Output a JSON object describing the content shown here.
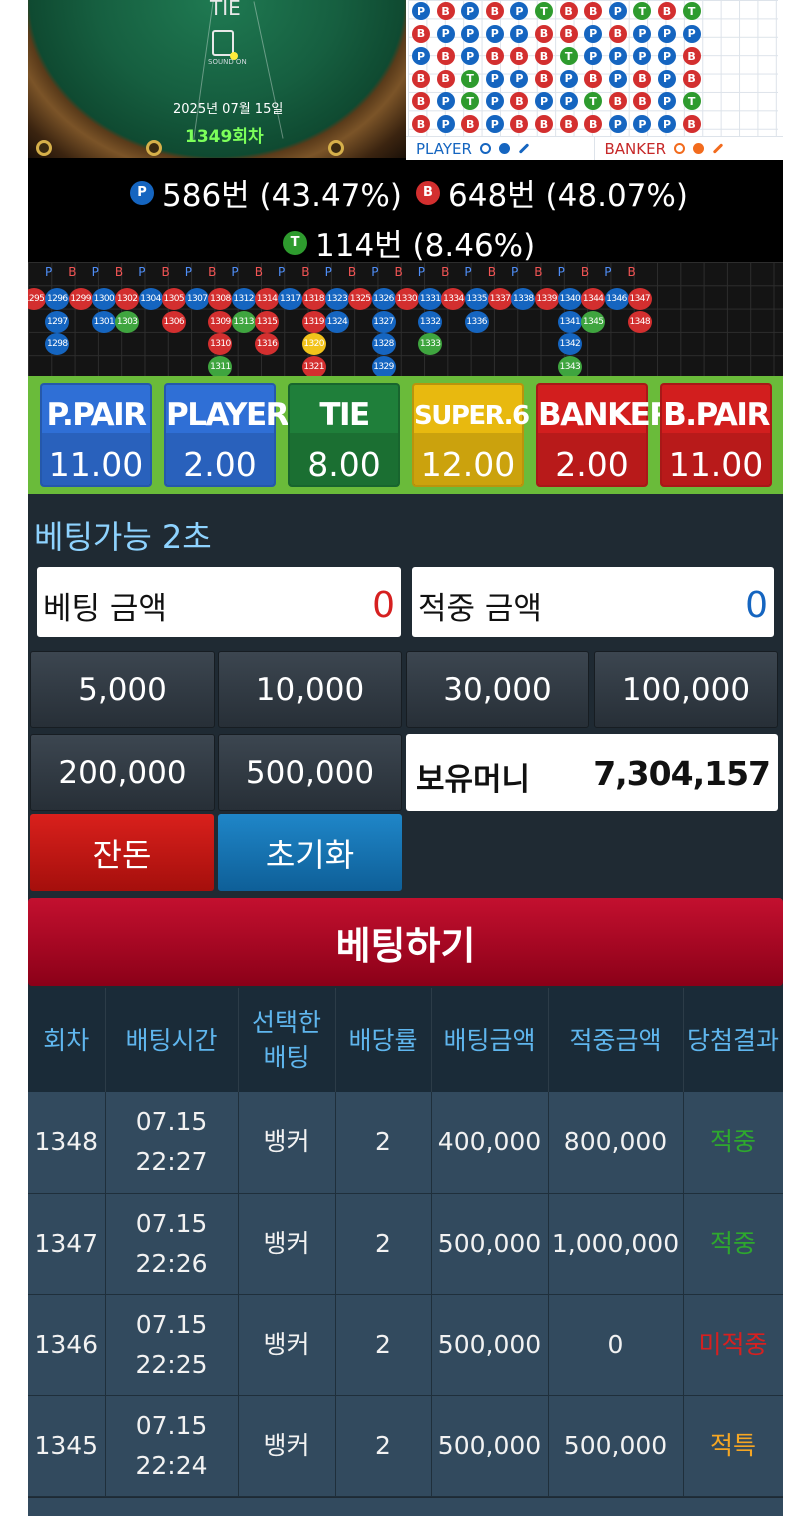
{
  "table_view": {
    "tie_label": "TIE",
    "sound_label": "SOUND ON",
    "date": "2025년 07월 15일",
    "round": "1349회차"
  },
  "bead_road": {
    "rows": [
      [
        "P",
        "B",
        "P",
        "B",
        "P",
        "T",
        "B",
        "B",
        "P",
        "T",
        "B",
        "T"
      ],
      [
        "B",
        "P",
        "P",
        "P",
        "P",
        "B",
        "B",
        "P",
        "B",
        "P",
        "P",
        "P"
      ],
      [
        "P",
        "B",
        "P",
        "B",
        "B",
        "B",
        "T",
        "P",
        "P",
        "P",
        "P",
        "B"
      ],
      [
        "B",
        "B",
        "T",
        "P",
        "P",
        "B",
        "P",
        "B",
        "P",
        "B",
        "P",
        "B"
      ],
      [
        "B",
        "P",
        "T",
        "P",
        "B",
        "P",
        "P",
        "T",
        "B",
        "B",
        "P",
        "T"
      ],
      [
        "B",
        "P",
        "B",
        "P",
        "B",
        "B",
        "B",
        "B",
        "P",
        "P",
        "P",
        "B"
      ]
    ],
    "legend_player": "PLAYER",
    "legend_banker": "BANKER"
  },
  "stats": {
    "player": {
      "icon": "P",
      "text": "586번 (43.47%)"
    },
    "banker": {
      "icon": "B",
      "text": "648번 (48.07%)"
    },
    "tie": {
      "icon": "T",
      "text": "114번 (8.46%)"
    }
  },
  "history_board": {
    "headers": [
      "P",
      "B",
      "P",
      "B",
      "P",
      "B",
      "P",
      "B",
      "P",
      "B",
      "P",
      "B",
      "P",
      "B",
      "P",
      "B",
      "P",
      "B",
      "P",
      "B",
      "P",
      "B",
      "P",
      "B",
      "P",
      "B"
    ],
    "columns": [
      [
        {
          "n": "1295",
          "c": "B"
        }
      ],
      [
        {
          "n": "1296",
          "c": "P"
        },
        {
          "n": "1297",
          "c": "P"
        },
        {
          "n": "1298",
          "c": "P"
        }
      ],
      [
        {
          "n": "1299",
          "c": "B"
        }
      ],
      [
        {
          "n": "1300",
          "c": "P"
        },
        {
          "n": "1301",
          "c": "P"
        }
      ],
      [
        {
          "n": "1302",
          "c": "B"
        },
        {
          "n": "1303",
          "c": "T"
        }
      ],
      [
        {
          "n": "1304",
          "c": "P"
        }
      ],
      [
        {
          "n": "1305",
          "c": "B"
        },
        {
          "n": "1306",
          "c": "B"
        }
      ],
      [
        {
          "n": "1307",
          "c": "P"
        }
      ],
      [
        {
          "n": "1308",
          "c": "B"
        },
        {
          "n": "1309",
          "c": "B"
        },
        {
          "n": "1310",
          "c": "B"
        },
        {
          "n": "1311",
          "c": "T"
        }
      ],
      [
        {
          "n": "1312",
          "c": "P"
        },
        {
          "n": "1313",
          "c": "T"
        }
      ],
      [
        {
          "n": "1314",
          "c": "B"
        },
        {
          "n": "1315",
          "c": "B"
        },
        {
          "n": "1316",
          "c": "B"
        }
      ],
      [
        {
          "n": "1317",
          "c": "P"
        }
      ],
      [
        {
          "n": "1318",
          "c": "B"
        },
        {
          "n": "1319",
          "c": "B"
        },
        {
          "n": "1320",
          "c": "Y"
        },
        {
          "n": "1321",
          "c": "B"
        }
      ],
      [
        {
          "n": "1323",
          "c": "P"
        },
        {
          "n": "1324",
          "c": "P"
        }
      ],
      [
        {
          "n": "1325",
          "c": "B"
        }
      ],
      [
        {
          "n": "1326",
          "c": "P"
        },
        {
          "n": "1327",
          "c": "P"
        },
        {
          "n": "1328",
          "c": "P"
        },
        {
          "n": "1329",
          "c": "P"
        }
      ],
      [
        {
          "n": "1330",
          "c": "B"
        }
      ],
      [
        {
          "n": "1331",
          "c": "P"
        },
        {
          "n": "1332",
          "c": "P"
        },
        {
          "n": "1333",
          "c": "T"
        }
      ],
      [
        {
          "n": "1334",
          "c": "B"
        }
      ],
      [
        {
          "n": "1335",
          "c": "P"
        },
        {
          "n": "1336",
          "c": "P"
        }
      ],
      [
        {
          "n": "1337",
          "c": "B"
        }
      ],
      [
        {
          "n": "1338",
          "c": "P"
        }
      ],
      [
        {
          "n": "1339",
          "c": "B"
        }
      ],
      [
        {
          "n": "1340",
          "c": "P"
        },
        {
          "n": "1341",
          "c": "P"
        },
        {
          "n": "1342",
          "c": "P"
        },
        {
          "n": "1343",
          "c": "T"
        }
      ],
      [
        {
          "n": "1344",
          "c": "B"
        },
        {
          "n": "1345",
          "c": "T"
        }
      ],
      [
        {
          "n": "1346",
          "c": "P"
        }
      ],
      [
        {
          "n": "1347",
          "c": "B"
        },
        {
          "n": "1348",
          "c": "B"
        }
      ]
    ]
  },
  "bets": [
    {
      "key": "ppair",
      "name": "P.PAIR",
      "odds": "11.00",
      "color": "#2f6fd6"
    },
    {
      "key": "player",
      "name": "PLAYER",
      "odds": "2.00",
      "color": "#2f6fd6"
    },
    {
      "key": "tie",
      "name": "TIE",
      "odds": "8.00",
      "color": "#1f7f3a"
    },
    {
      "key": "super6",
      "name": "SUPER.6",
      "odds": "12.00",
      "color": "#e8b90f"
    },
    {
      "key": "banker",
      "name": "BANKER",
      "odds": "2.00",
      "color": "#d21e1e"
    },
    {
      "key": "bpair",
      "name": "B.PAIR",
      "odds": "11.00",
      "color": "#d21e1e"
    }
  ],
  "panel": {
    "countdown": "베팅가능 2초",
    "bet_amount_label": "베팅 금액",
    "bet_amount_value": "0",
    "win_amount_label": "적중 금액",
    "win_amount_value": "0",
    "chips": [
      "5,000",
      "10,000",
      "30,000",
      "100,000",
      "200,000",
      "500,000"
    ],
    "balance_label": "보유머니",
    "balance_value": "7,304,157",
    "change_label": "잔돈",
    "reset_label": "초기화",
    "submit_label": "베팅하기"
  },
  "bet_history": {
    "headers": [
      "회차",
      "배팅시간",
      "선택한배팅",
      "배당률",
      "배팅금액",
      "적중금액",
      "당첨결과"
    ],
    "rows": [
      {
        "round": "1348",
        "time": "07.15\n22:27",
        "choice": "뱅커",
        "rate": "2",
        "bet": "400,000",
        "win": "800,000",
        "result": "적중",
        "result_type": "win"
      },
      {
        "round": "1347",
        "time": "07.15\n22:26",
        "choice": "뱅커",
        "rate": "2",
        "bet": "500,000",
        "win": "1,000,000",
        "result": "적중",
        "result_type": "win"
      },
      {
        "round": "1346",
        "time": "07.15\n22:25",
        "choice": "뱅커",
        "rate": "2",
        "bet": "500,000",
        "win": "0",
        "result": "미적중",
        "result_type": "lose"
      },
      {
        "round": "1345",
        "time": "07.15\n22:24",
        "choice": "뱅커",
        "rate": "2",
        "bet": "500,000",
        "win": "500,000",
        "result": "적특",
        "result_type": "special"
      }
    ]
  }
}
